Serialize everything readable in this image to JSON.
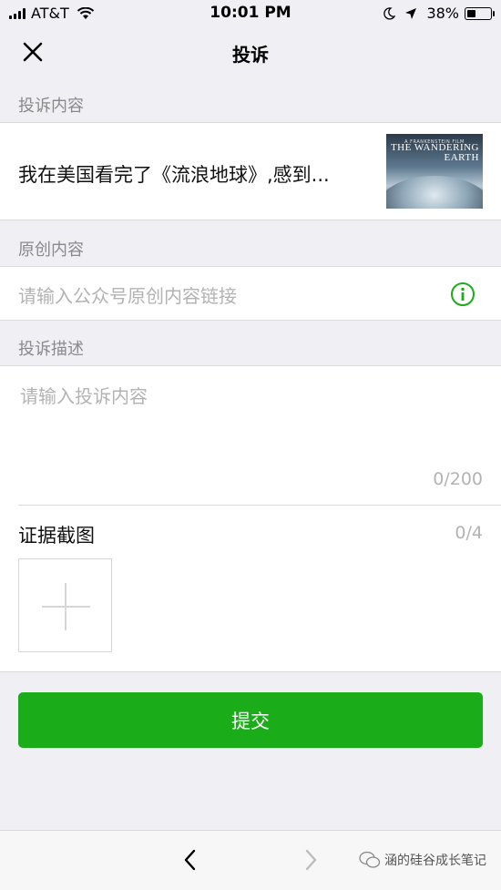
{
  "status_bar": {
    "carrier": "AT&T",
    "time": "10:01 PM",
    "battery_percent": "38%",
    "battery_level": 0.38,
    "icons": [
      "signal-icon",
      "wifi-icon",
      "moon-icon",
      "location-arrow-icon",
      "battery-icon"
    ]
  },
  "nav": {
    "title": "投诉",
    "close_icon": "close-icon"
  },
  "complaint_content": {
    "label": "投诉内容",
    "article_title": "我在美国看完了《流浪地球》,感到...",
    "thumbnail": {
      "small_text": "A FRANKENSTEIN FILM",
      "title_line1": "THE WANDERING",
      "title_line2": "EARTH"
    }
  },
  "original_content": {
    "label": "原创内容",
    "placeholder": "请输入公众号原创内容链接",
    "info_icon": "info-icon"
  },
  "description": {
    "label": "投诉描述",
    "placeholder": "请输入投诉内容",
    "counter": "0/200"
  },
  "evidence": {
    "label": "证据截图",
    "counter": "0/4",
    "add_icon": "plus-icon"
  },
  "submit_label": "提交",
  "toolbar": {
    "back_icon": "chevron-left-icon",
    "forward_icon": "chevron-right-icon",
    "watermark": "涵的硅谷成长笔记"
  },
  "colors": {
    "accent_green": "#1aad19",
    "background": "#efeff4",
    "placeholder_gray": "#b3b3b3",
    "label_gray": "#8a8a8a"
  }
}
